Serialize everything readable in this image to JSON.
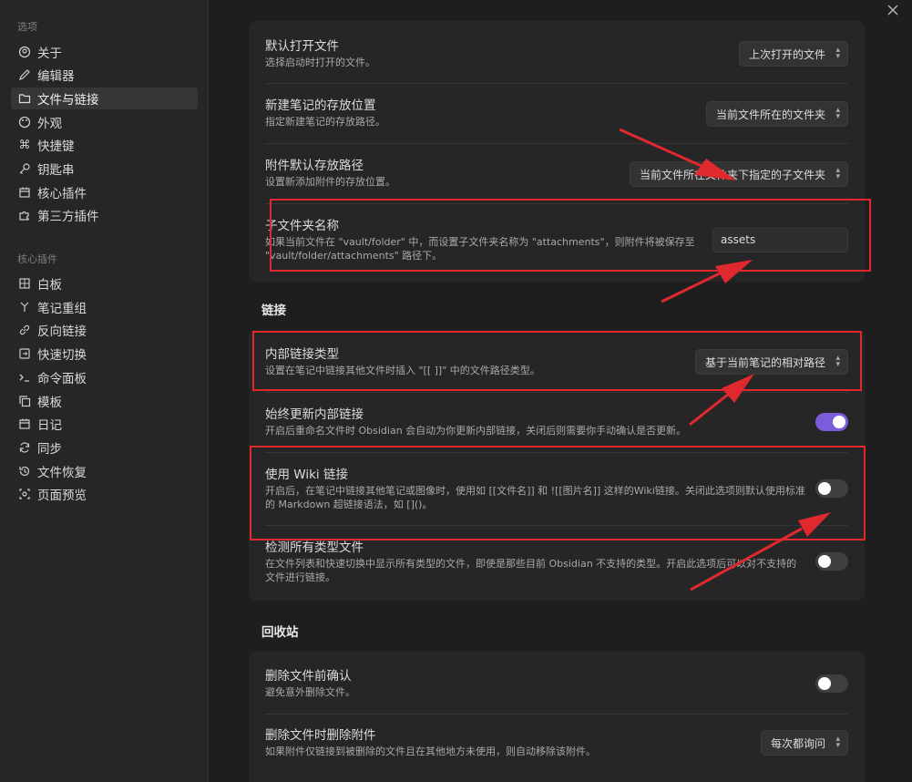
{
  "sidebar": {
    "section_options": "选项",
    "section_core_plugins": "核心插件",
    "options": [
      {
        "label": "关于",
        "icon": "circle-user-icon"
      },
      {
        "label": "编辑器",
        "icon": "pencil-icon"
      },
      {
        "label": "文件与链接",
        "icon": "folder-icon"
      },
      {
        "label": "外观",
        "icon": "palette-icon"
      },
      {
        "label": "快捷键",
        "icon": "command-icon"
      },
      {
        "label": "钥匙串",
        "icon": "key-icon"
      },
      {
        "label": "核心插件",
        "icon": "calendar-icon"
      },
      {
        "label": "第三方插件",
        "icon": "puzzle-icon"
      }
    ],
    "core_plugins": [
      {
        "label": "白板",
        "icon": "grid-icon"
      },
      {
        "label": "笔记重组",
        "icon": "merge-icon"
      },
      {
        "label": "反向链接",
        "icon": "link-icon"
      },
      {
        "label": "快速切换",
        "icon": "switch-icon"
      },
      {
        "label": "命令面板",
        "icon": "terminal-icon"
      },
      {
        "label": "模板",
        "icon": "copy-icon"
      },
      {
        "label": "日记",
        "icon": "calendar-icon"
      },
      {
        "label": "同步",
        "icon": "sync-icon"
      },
      {
        "label": "文件恢复",
        "icon": "history-icon"
      },
      {
        "label": "页面预览",
        "icon": "preview-icon"
      }
    ]
  },
  "files_card": {
    "default_open": {
      "name": "默认打开文件",
      "desc": "选择启动时打开的文件。",
      "value": "上次打开的文件"
    },
    "new_note_location": {
      "name": "新建笔记的存放位置",
      "desc": "指定新建笔记的存放路径。",
      "value": "当前文件所在的文件夹"
    },
    "attachment_location": {
      "name": "附件默认存放路径",
      "desc": "设置新添加附件的存放位置。",
      "value": "当前文件所在文件夹下指定的子文件夹"
    },
    "subfolder_name": {
      "name": "子文件夹名称",
      "desc_line1": "如果当前文件在 \"vault/folder\" 中，而设置子文件夹名称为 \"attachments\"，则附件将被保存至",
      "desc_line2": "\"vault/folder/attachments\" 路径下。",
      "value": "assets"
    }
  },
  "links": {
    "heading": "链接",
    "link_type": {
      "name": "内部链接类型",
      "desc": "设置在笔记中链接其他文件时插入 \"[[ ]]\" 中的文件路径类型。",
      "value": "基于当前笔记的相对路径"
    },
    "auto_update": {
      "name": "始终更新内部链接",
      "desc": "开启后重命名文件时 Obsidian 会自动为你更新内部链接，关闭后则需要你手动确认是否更新。",
      "enabled": true
    },
    "wiki_links": {
      "name": "使用 Wiki 链接",
      "desc_line1": "开启后，在笔记中链接其他笔记或图像时，使用如 [[文件名]] 和 ![[图片名]] 这样的Wiki链接。关闭此选项则默认使用标准",
      "desc_line2": "的 Markdown 超链接语法，如 []()。",
      "enabled": false
    },
    "detect_all": {
      "name": "检测所有类型文件",
      "desc_line1": "在文件列表和快速切换中显示所有类型的文件，即使是那些目前 Obsidian 不支持的类型。开启此选项后可以对不支持的",
      "desc_line2": "文件进行链接。",
      "enabled": false
    }
  },
  "trash": {
    "heading": "回收站",
    "confirm_delete": {
      "name": "删除文件前确认",
      "desc": "避免意外删除文件。",
      "enabled": false
    },
    "delete_attachments": {
      "name": "删除文件时删除附件",
      "desc": "如果附件仅链接到被删除的文件且在其他地方未使用，则自动移除该附件。",
      "value": "每次都询问"
    }
  },
  "colors": {
    "accent": "#7b5ddb",
    "annotation": "#e0282f",
    "background": "#1e1e1e",
    "card": "#262626"
  }
}
